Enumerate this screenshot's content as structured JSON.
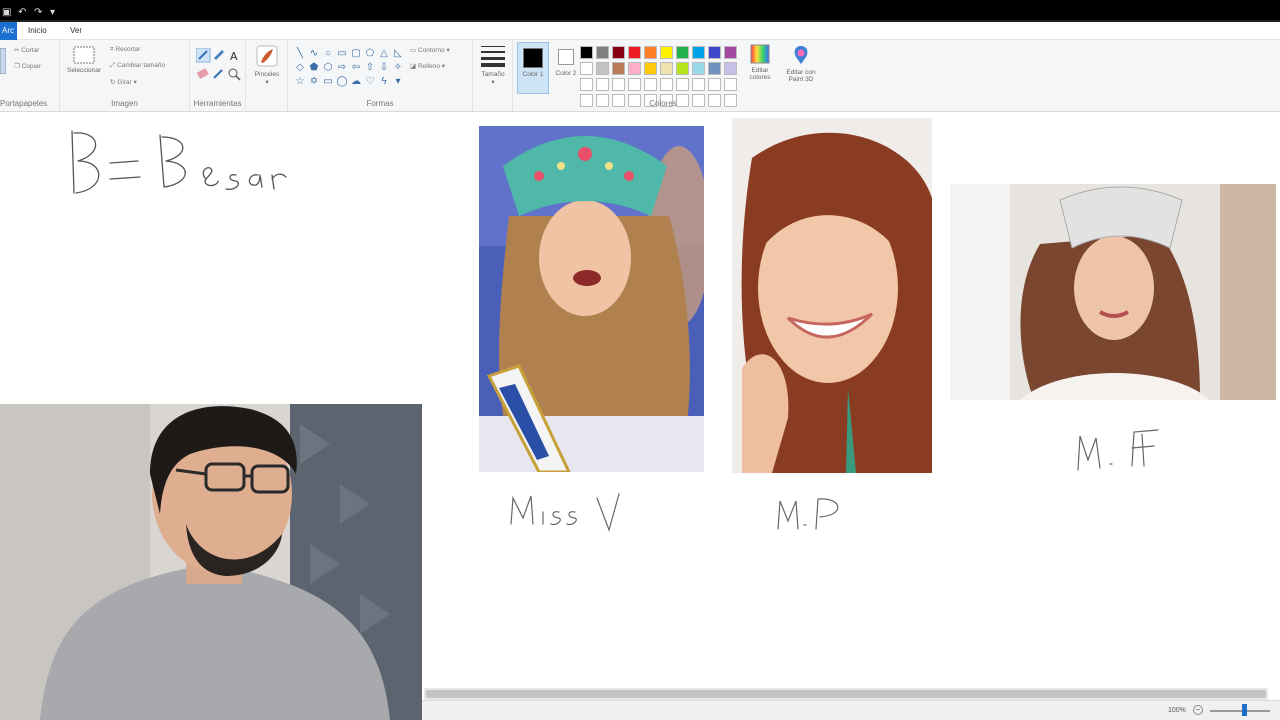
{
  "tabs": [
    {
      "label": "Arc"
    },
    {
      "label": "Inicio"
    },
    {
      "label": "Ver"
    }
  ],
  "ribbon": {
    "clipboard": {
      "label": "Portapapeles",
      "cut": "Cortar",
      "copy": "Copiar"
    },
    "image": {
      "label": "Imagen",
      "select": "Seleccionar",
      "crop": "Recortar",
      "resize": "Cambiar tamaño",
      "rotate": "Girar"
    },
    "tools": {
      "label": "Herramientas"
    },
    "brushes": {
      "label": "Pinceles"
    },
    "shapes": {
      "label": "Formas",
      "outline": "Contorno",
      "fill": "Relleno"
    },
    "size": {
      "label": "Tamaño"
    },
    "colors": {
      "label": "Colores",
      "color1": "Color 1",
      "color2": "Color 2",
      "edit_colors": "Editar colores",
      "paint3d": "Editar con Paint 3D",
      "color1_value": "#000000",
      "color2_value": "#ffffff",
      "palette_row1": [
        "#000000",
        "#7f7f7f",
        "#880015",
        "#ed1c24",
        "#ff7f27",
        "#fff200",
        "#22b14c",
        "#00a2e8",
        "#3f48cc",
        "#a349a4"
      ],
      "palette_row2": [
        "#ffffff",
        "#c3c3c3",
        "#b97a57",
        "#ffaec9",
        "#ffc90e",
        "#efe4b0",
        "#b5e61d",
        "#99d9ea",
        "#7092be",
        "#c8bfe7"
      ],
      "palette_row3": [
        "#ffffff",
        "#ffffff",
        "#ffffff",
        "#ffffff",
        "#ffffff",
        "#ffffff",
        "#ffffff",
        "#ffffff",
        "#ffffff",
        "#ffffff"
      ],
      "palette_row4": [
        "#ffffff",
        "#ffffff",
        "#ffffff",
        "#ffffff",
        "#ffffff",
        "#ffffff",
        "#ffffff",
        "#ffffff",
        "#ffffff",
        "#ffffff"
      ]
    }
  },
  "status": {
    "zoom": "100%"
  }
}
